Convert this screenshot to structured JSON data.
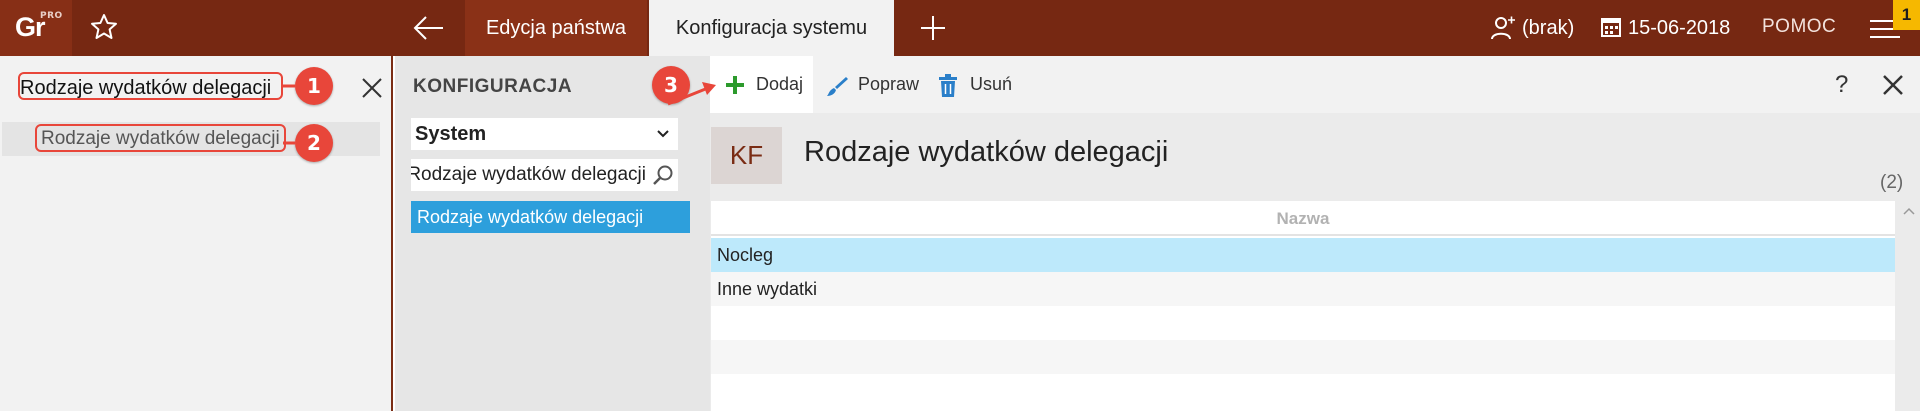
{
  "app": {
    "logo_text": "Gr",
    "logo_sup": "PRO"
  },
  "header": {
    "tabs": [
      {
        "label": "Edycja państwa",
        "active": false
      },
      {
        "label": "Konfiguracja systemu",
        "active": true
      }
    ],
    "user": "(brak)",
    "date": "15-06-2018",
    "help": "POMOC",
    "notification_count": "1",
    "icons": [
      "star-icon",
      "back-arrow-icon",
      "plus-icon",
      "user-icon",
      "calendar-icon",
      "menu-icon"
    ]
  },
  "left_panel": {
    "search_value": "Rodzaje wydatków delegacji",
    "results": [
      "Rodzaje wydatków delegacji"
    ]
  },
  "callouts": [
    "1",
    "2",
    "3"
  ],
  "config": {
    "title": "KONFIGURACJA",
    "select_value": "System",
    "search_value": "Rodzaje wydatków delegacji",
    "items": [
      "Rodzaje wydatków delegacji"
    ]
  },
  "toolbar": {
    "add_label": "Dodaj",
    "edit_label": "Popraw",
    "delete_label": "Usuń",
    "help_label": "?"
  },
  "main": {
    "badge": "KF",
    "title": "Rodzaje wydatków delegacji",
    "count": "(2)",
    "table": {
      "columns": [
        "Nazwa"
      ],
      "rows": [
        {
          "name": "Nocleg",
          "selected": true
        },
        {
          "name": "Inne wydatki",
          "selected": false
        }
      ]
    }
  },
  "colors": {
    "topbar": "#762812",
    "accent_blue": "#2d9fdc",
    "selected_row": "#bde9fb",
    "callout_red": "#e8463a",
    "add_green": "#2c9a2c",
    "badge_yellow": "#f6b800"
  }
}
